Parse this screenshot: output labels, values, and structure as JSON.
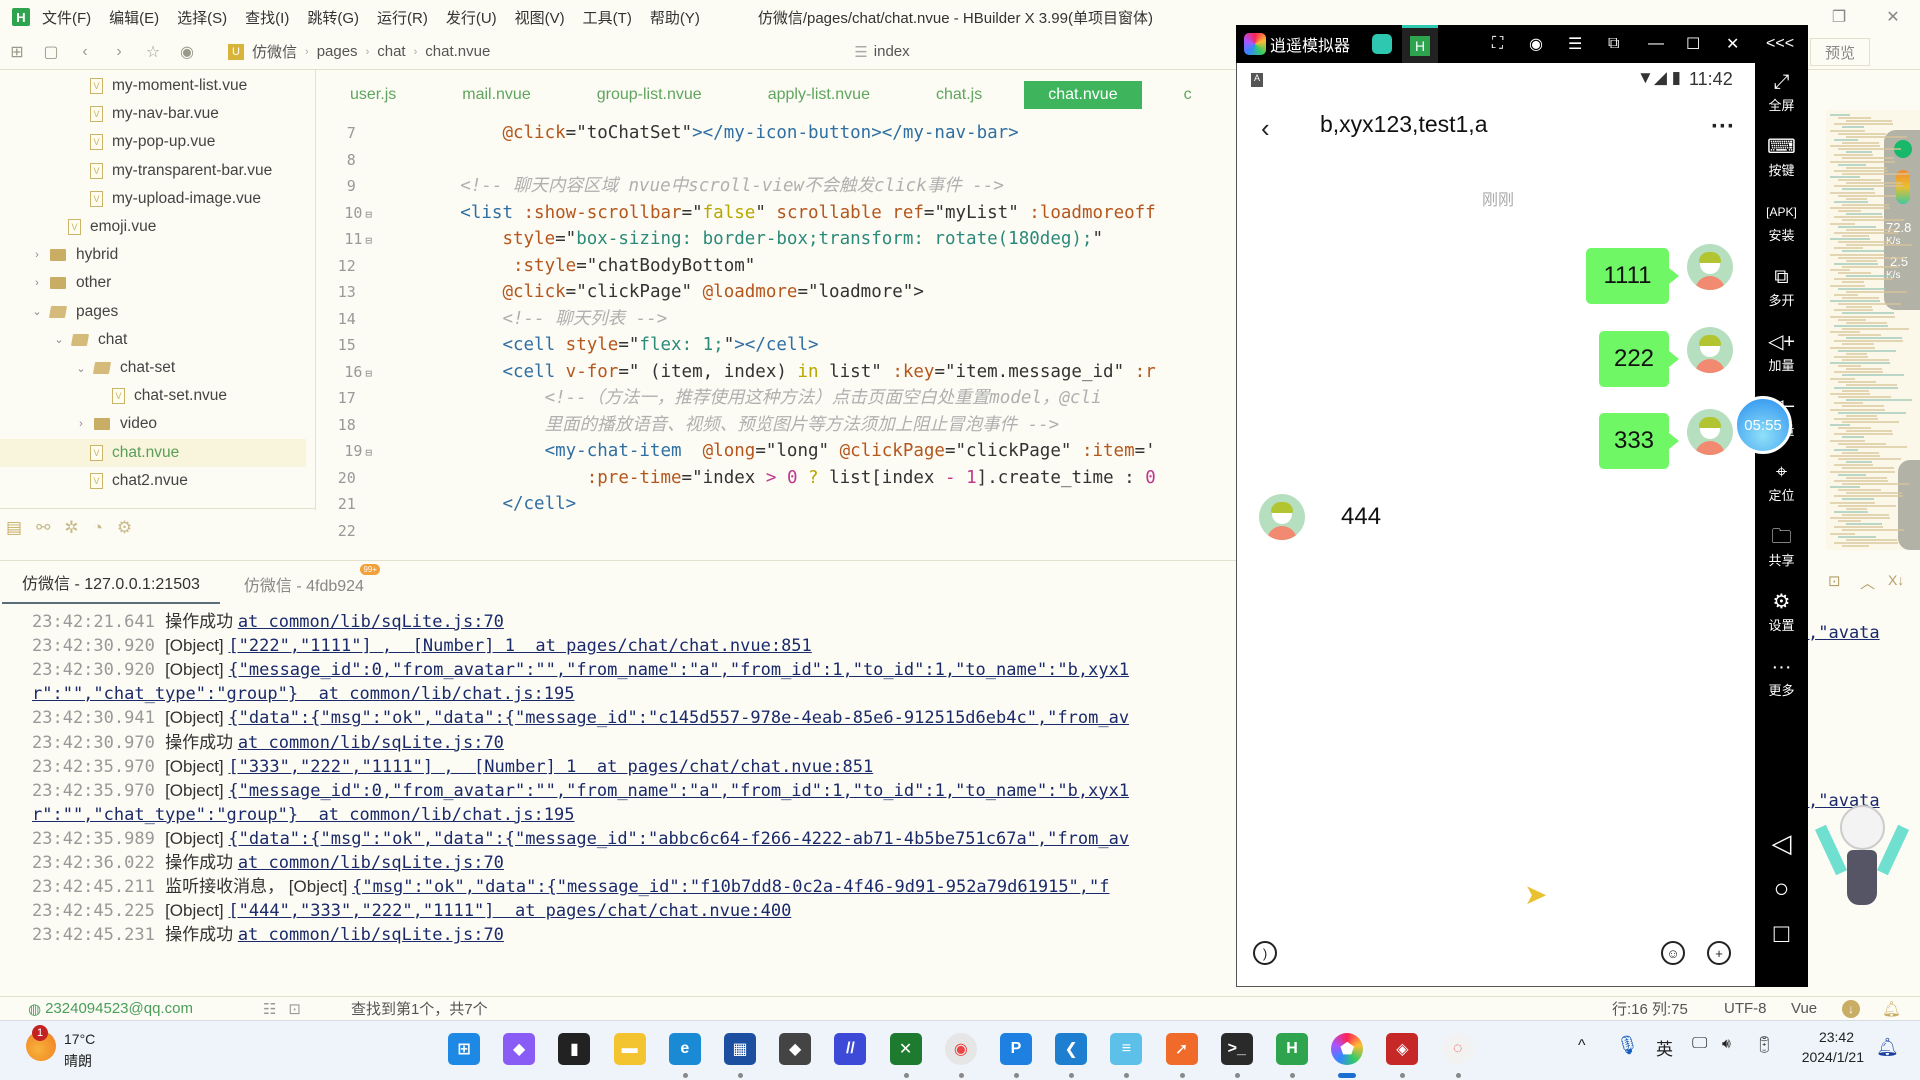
{
  "menubar": {
    "items": [
      "文件(F)",
      "编辑(E)",
      "选择(S)",
      "查找(I)",
      "跳转(G)",
      "运行(R)",
      "发行(U)",
      "视图(V)",
      "工具(T)",
      "帮助(Y)"
    ],
    "window_title": "仿微信/pages/chat/chat.nvue - HBuilder X 3.99(单项目窗体)",
    "logo": "H"
  },
  "toolbar": {
    "breadcrumb": [
      "仿微信",
      "pages",
      "chat",
      "chat.nvue"
    ],
    "project_icon": "U",
    "outline_label": "index",
    "preview_label": "预览"
  },
  "tree": {
    "items": [
      {
        "label": "my-moment-list.vue",
        "type": "file",
        "depth": 3
      },
      {
        "label": "my-nav-bar.vue",
        "type": "file",
        "depth": 3
      },
      {
        "label": "my-pop-up.vue",
        "type": "file",
        "depth": 3
      },
      {
        "label": "my-transparent-bar.vue",
        "type": "file",
        "depth": 3
      },
      {
        "label": "my-upload-image.vue",
        "type": "file",
        "depth": 3
      },
      {
        "label": "emoji.vue",
        "type": "file",
        "depth": 2
      },
      {
        "label": "hybrid",
        "type": "folder",
        "depth": 1,
        "expanded": false
      },
      {
        "label": "other",
        "type": "folder",
        "depth": 1,
        "expanded": false
      },
      {
        "label": "pages",
        "type": "folder",
        "depth": 1,
        "expanded": true
      },
      {
        "label": "chat",
        "type": "folder",
        "depth": 2,
        "expanded": true
      },
      {
        "label": "chat-set",
        "type": "folder",
        "depth": 3,
        "expanded": true
      },
      {
        "label": "chat-set.nvue",
        "type": "file",
        "depth": 4
      },
      {
        "label": "video",
        "type": "folder",
        "depth": 3,
        "expanded": false
      },
      {
        "label": "chat.nvue",
        "type": "file",
        "depth": 3,
        "selected": true
      },
      {
        "label": "chat2.nvue",
        "type": "file",
        "depth": 3
      }
    ]
  },
  "editor": {
    "tabs": [
      {
        "label": "user.js",
        "active": false
      },
      {
        "label": "mail.nvue",
        "active": false
      },
      {
        "label": "group-list.nvue",
        "active": false
      },
      {
        "label": "apply-list.nvue",
        "active": false
      },
      {
        "label": "chat.js",
        "active": false
      },
      {
        "label": "chat.nvue",
        "active": true
      },
      {
        "label": "c",
        "active": false
      }
    ],
    "line_numbers": [
      "7",
      "8",
      "9",
      "10",
      "11",
      "12",
      "13",
      "14",
      "15",
      "16",
      "17",
      "18",
      "19",
      "20",
      "21",
      "22"
    ],
    "fold_markers": [
      "10",
      "11",
      "16",
      "19"
    ],
    "lines": [
      {
        "indent": "            ",
        "tokens": [
          [
            "at",
            "@click"
          ],
          [
            "df",
            "="
          ],
          [
            "df",
            "\"toChatSet\""
          ],
          [
            "tg",
            "></my-icon-button></my-nav-bar>"
          ]
        ]
      },
      {
        "indent": "",
        "tokens": []
      },
      {
        "indent": "        ",
        "tokens": [
          [
            "cm",
            "<!-- 聊天内容区域 nvue中scroll-view不会触发click事件 -->"
          ]
        ]
      },
      {
        "indent": "        ",
        "tokens": [
          [
            "tg",
            "<list "
          ],
          [
            "at",
            ":show-scrollbar"
          ],
          [
            "df",
            "=\""
          ],
          [
            "kw",
            "false"
          ],
          [
            "df",
            "\" "
          ],
          [
            "at",
            "scrollable ref"
          ],
          [
            "df",
            "=\"myList\" "
          ],
          [
            "at",
            ":loadmoreoff"
          ]
        ]
      },
      {
        "indent": "            ",
        "tokens": [
          [
            "at",
            "style"
          ],
          [
            "df",
            "=\""
          ],
          [
            "st",
            "box-sizing: border-box;transform: rotate(180deg);"
          ],
          [
            "df",
            "\""
          ]
        ]
      },
      {
        "indent": "             ",
        "tokens": [
          [
            "at",
            ":style"
          ],
          [
            "df",
            "=\"chatBodyBottom\""
          ]
        ]
      },
      {
        "indent": "            ",
        "tokens": [
          [
            "at",
            "@click"
          ],
          [
            "df",
            "=\"clickPage\" "
          ],
          [
            "at",
            "@loadmore"
          ],
          [
            "df",
            "=\"loadmore\">"
          ]
        ]
      },
      {
        "indent": "            ",
        "tokens": [
          [
            "cm",
            "<!-- 聊天列表 -->"
          ]
        ]
      },
      {
        "indent": "            ",
        "tokens": [
          [
            "tg",
            "<cell "
          ],
          [
            "at",
            "style"
          ],
          [
            "df",
            "=\""
          ],
          [
            "st",
            "flex: 1;"
          ],
          [
            "df",
            "\""
          ],
          [
            "tg",
            "></cell>"
          ]
        ]
      },
      {
        "indent": "            ",
        "tokens": [
          [
            "tg",
            "<cell "
          ],
          [
            "at",
            "v-for"
          ],
          [
            "df",
            "=\" (item, index) "
          ],
          [
            "kw",
            "in"
          ],
          [
            "df",
            " list\" "
          ],
          [
            "at",
            ":key"
          ],
          [
            "df",
            "=\"item.message_id\" "
          ],
          [
            "at",
            ":r"
          ]
        ]
      },
      {
        "indent": "                ",
        "tokens": [
          [
            "cm",
            "<!--（方法一，推荐使用这种方法）点击页面空白处重置model，@cli"
          ]
        ]
      },
      {
        "indent": "                ",
        "tokens": [
          [
            "cm",
            "里面的播放语音、视频、预览图片等方法须加上阻止冒泡事件 -->"
          ]
        ]
      },
      {
        "indent": "                ",
        "tokens": [
          [
            "tg",
            "<my-chat-item  "
          ],
          [
            "at",
            "@long"
          ],
          [
            "df",
            "=\"long\" "
          ],
          [
            "at",
            "@clickPage"
          ],
          [
            "df",
            "=\"clickPage\" "
          ],
          [
            "at",
            ":item"
          ],
          [
            "df",
            "='"
          ]
        ]
      },
      {
        "indent": "                    ",
        "tokens": [
          [
            "at",
            ":pre-time"
          ],
          [
            "df",
            "=\"index "
          ],
          [
            "nm",
            ">"
          ],
          [
            "df",
            " "
          ],
          [
            "nm",
            "0"
          ],
          [
            "df",
            " "
          ],
          [
            "kw",
            "?"
          ],
          [
            "df",
            " list[index "
          ],
          [
            "nm",
            "-"
          ],
          [
            "df",
            " "
          ],
          [
            "nm",
            "1"
          ],
          [
            "df",
            "].create_time : "
          ],
          [
            "nm",
            "0"
          ]
        ]
      },
      {
        "indent": "            ",
        "tokens": [
          [
            "tg",
            "</cell>"
          ]
        ]
      },
      {
        "indent": "",
        "tokens": []
      }
    ]
  },
  "console": {
    "tabs": [
      {
        "label": "仿微信 - 127.0.0.1:21503",
        "active": true
      },
      {
        "label": "仿微信 - 4fdb924",
        "active": false,
        "badge": "99+"
      }
    ],
    "lines": [
      {
        "time": "23:42:21.641",
        "text": "操作成功 ",
        "link": "at common/lib/sqLite.js:70"
      },
      {
        "time": "23:42:30.920",
        "text": "[Object] ",
        "link": "[\"222\",\"1111\"] ,  [Number] 1  at pages/chat/chat.nvue:851"
      },
      {
        "time": "23:42:30.920",
        "text": "[Object] ",
        "link": "{\"message_id\":0,\"from_avatar\":\"\",\"from_name\":\"a\",\"from_id\":1,\"to_id\":1,\"to_name\":\"b,xyx1"
      },
      {
        "time": "",
        "text": "",
        "link": "r\":\"\",\"chat_type\":\"group\"}  at common/lib/chat.js:195"
      },
      {
        "time": "23:42:30.941",
        "text": "[Object] ",
        "link": "{\"data\":{\"msg\":\"ok\",\"data\":{\"message_id\":\"c145d557-978e-4eab-85e6-912515d6eb4c\",\"from_av"
      },
      {
        "time": "23:42:30.970",
        "text": "操作成功 ",
        "link": "at common/lib/sqLite.js:70"
      },
      {
        "time": "23:42:35.970",
        "text": "[Object] ",
        "link": "[\"333\",\"222\",\"1111\"] ,  [Number] 1  at pages/chat/chat.nvue:851"
      },
      {
        "time": "23:42:35.970",
        "text": "[Object] ",
        "link": "{\"message_id\":0,\"from_avatar\":\"\",\"from_name\":\"a\",\"from_id\":1,\"to_id\":1,\"to_name\":\"b,xyx1"
      },
      {
        "time": "",
        "text": "",
        "link": "r\":\"\",\"chat_type\":\"group\"}  at common/lib/chat.js:195"
      },
      {
        "time": "23:42:35.989",
        "text": "[Object] ",
        "link": "{\"data\":{\"msg\":\"ok\",\"data\":{\"message_id\":\"abbc6c64-f266-4222-ab71-4b5be751c67a\",\"from_av"
      },
      {
        "time": "23:42:36.022",
        "text": "操作成功 ",
        "link": "at common/lib/sqLite.js:70"
      },
      {
        "time": "23:42:45.211",
        "text": "监听接收消息， [Object] ",
        "link": "{\"msg\":\"ok\",\"data\":{\"message_id\":\"f10b7dd8-0c2a-4f46-9d91-952a79d61915\",\"f"
      },
      {
        "time": "23:42:45.225",
        "text": "[Object] ",
        "link": "[\"444\",\"333\",\"222\",\"1111\"]  at pages/chat/chat.nvue:400"
      },
      {
        "time": "23:42:45.231",
        "text": "操作成功 ",
        "link": "at common/lib/sqLite.js:70"
      }
    ],
    "overflow_right": ",\"avata"
  },
  "statusbar": {
    "user": "2324094523@qq.com",
    "find_result": "查找到第1个，共7个",
    "position": "行:16  列:75",
    "encoding": "UTF-8",
    "language": "Vue"
  },
  "emulator": {
    "app_name": "逍遥模拟器",
    "tab_icon": "H",
    "phone_time": "11:42",
    "chat_title": "b,xyx123,test1,a",
    "time_divider": "刚刚",
    "messages": [
      {
        "text": "1111",
        "mine": true
      },
      {
        "text": "222",
        "mine": true
      },
      {
        "text": "333",
        "mine": true
      },
      {
        "text": "444",
        "mine": false
      }
    ],
    "floating_timer": "05:55",
    "side_buttons": [
      "全屏",
      "按键",
      "安装",
      "多开",
      "加量",
      "减量",
      "定位",
      "共享",
      "设置",
      "更多"
    ],
    "collapse_label": "<<<"
  },
  "minimap": {
    "net_up": "72.8",
    "net_up_unit": "K/s",
    "net_down": "2.5",
    "net_down_unit": "K/s"
  },
  "taskbar": {
    "weather_temp": "17°C",
    "weather_desc": "晴朗",
    "weather_badge": "1",
    "ime": "英",
    "clock_time": "23:42",
    "clock_date": "2024/1/21",
    "apps": [
      "start",
      "copilot",
      "terminal-black",
      "file-explorer",
      "edge",
      "store",
      "shield-app",
      "code-app",
      "xbox",
      "chrome",
      "p-app",
      "vscode",
      "notepad",
      "send-app",
      "terminal",
      "hbuilder",
      "memu",
      "redis",
      "app-circle"
    ]
  }
}
